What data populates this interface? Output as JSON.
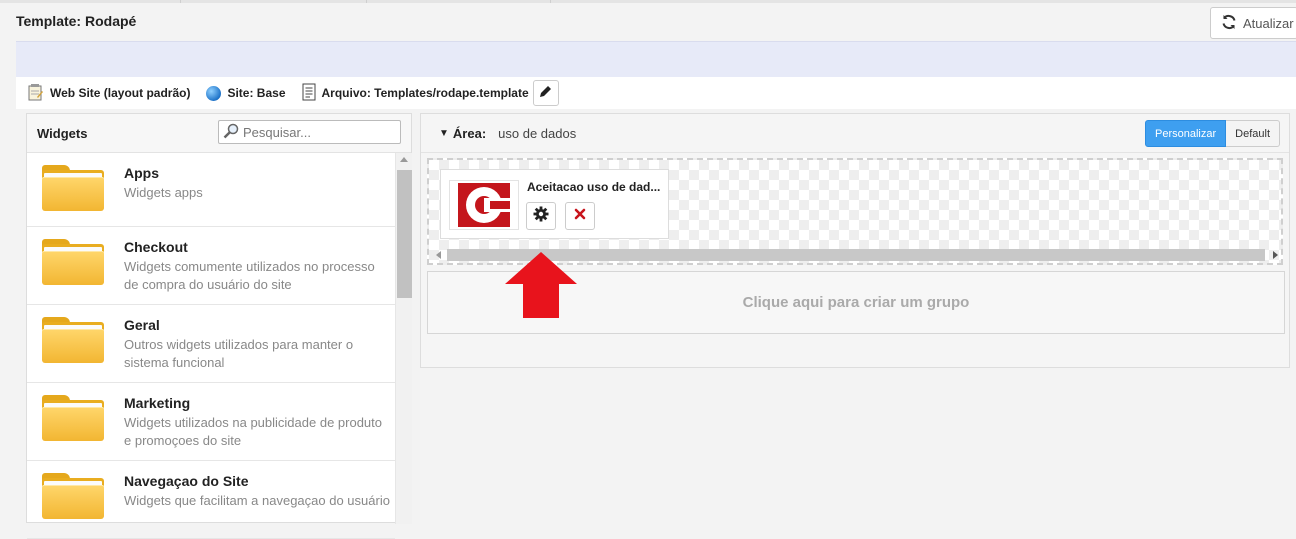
{
  "header": {
    "title": "Template: Rodapé",
    "refresh_label": "Atualizar"
  },
  "meta": {
    "website": "Web Site (layout padrão)",
    "site": "Site: Base",
    "file": "Arquivo: Templates/rodape.template"
  },
  "widgets_panel": {
    "title": "Widgets",
    "search_placeholder": "Pesquisar...",
    "items": [
      {
        "name": "Apps",
        "desc": "Widgets apps"
      },
      {
        "name": "Checkout",
        "desc": "Widgets comumente utilizados no processo de compra do usuário do site"
      },
      {
        "name": "Geral",
        "desc": "Outros widgets utilizados para manter o sistema funcional"
      },
      {
        "name": "Marketing",
        "desc": "Widgets utilizados na publicidade de produto e promoçoes do site"
      },
      {
        "name": "Navegaçao do Site",
        "desc": "Widgets que facilitam a navegaçao do usuário"
      }
    ]
  },
  "area": {
    "label": "Área:",
    "value": "uso de dados",
    "mode_custom": "Personalizar",
    "mode_default": "Default",
    "widget_title": "Aceitacao uso de dad...",
    "create_group": "Clique aqui para criar um grupo"
  },
  "colors": {
    "accent": "#3e9ff0",
    "logo_red": "#c4161c",
    "arrow_red": "#e8131c"
  }
}
